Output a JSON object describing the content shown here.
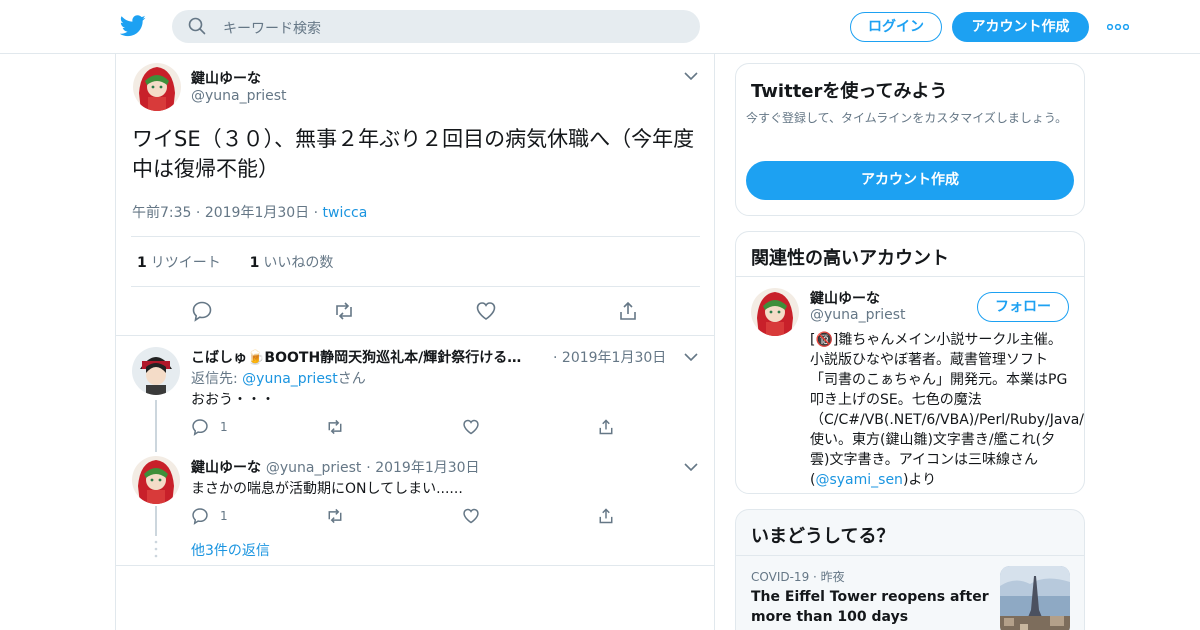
{
  "colors": {
    "accent": "#1da1f2",
    "link": "#1b95e0",
    "secondary": "#657786",
    "border": "#e1e8ed"
  },
  "header": {
    "logo": "twitter-bird-icon",
    "search_placeholder": "キーワード検索",
    "login_label": "ログイン",
    "signup_label": "アカウント作成",
    "more_icon": "more-dots-icon"
  },
  "tweet": {
    "name": "鍵山ゆーな",
    "handle": "@yuna_priest",
    "text": "ワイSE（３０）、無事２年ぶり２回目の病気休職へ（今年度中は復帰不能）",
    "time": "午前7:35",
    "date": "2019年1月30日",
    "source": "twicca",
    "retweet_count": "1",
    "retweet_label": "リツイート",
    "like_count": "1",
    "like_label": "いいねの数"
  },
  "replies": [
    {
      "name": "こばしゅ🍺BOOTH静岡天狗巡礼本/輝針祭行ける…",
      "date": "2019年1月30日",
      "reply_to_prefix": "返信先: ",
      "reply_to_handle": "@yuna_priest",
      "reply_to_suffix": "さん",
      "text": "おおう・・・",
      "reply_count": "1"
    },
    {
      "name": "鍵山ゆーな",
      "handle": "@yuna_priest",
      "date": "2019年1月30日",
      "text": "まさかの喘息が活動期にONしてしまい......",
      "reply_count": "1"
    }
  ],
  "more_replies": "他3件の返信",
  "sidebar": {
    "signup_card": {
      "title": "Twitterを使ってみよう",
      "subtitle": "今すぐ登録して、タイムラインをカスタマイズしましょう。",
      "button": "アカウント作成"
    },
    "related": {
      "title": "関連性の高いアカウント",
      "name": "鍵山ゆーな",
      "handle": "@yuna_priest",
      "follow": "フォロー",
      "bio_before": "[🔞]雛ちゃんメイン小説サークル主催。小説版ひなやぼ著者。蔵書管理ソフト「司書のこぁちゃん」開発元。本業はPG叩き上げのSE。七色の魔法（C/C#/VB(.NET/6/VBA)/Perl/Ruby/Java/PHP）使い。東方(鍵山雛)文字書き/艦これ(夕雲)文字書き。アイコンは三味線さん(",
      "bio_mention": "@syami_sen",
      "bio_after": ")より"
    },
    "trends": {
      "title": "いまどうしてる？",
      "category": "COVID-19",
      "when": "昨夜",
      "headline": "The Eiffel Tower reopens after more than 100 days"
    }
  }
}
